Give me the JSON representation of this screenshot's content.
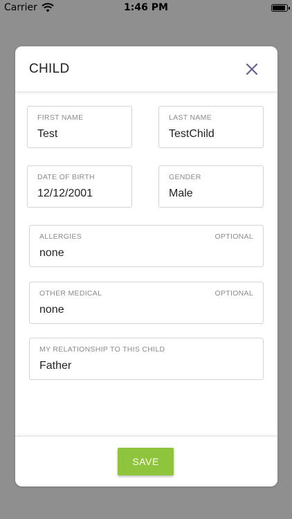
{
  "status_bar": {
    "carrier": "Carrier",
    "time": "1:46 PM",
    "icons": [
      "wifi-icon",
      "battery-icon"
    ]
  },
  "modal": {
    "title": "CHILD",
    "close_icon": "close-icon",
    "fields": {
      "first_name": {
        "label": "FIRST NAME",
        "value": "Test"
      },
      "last_name": {
        "label": "LAST NAME",
        "value": "TestChild"
      },
      "date_of_birth": {
        "label": "DATE OF BIRTH",
        "value": "12/12/2001"
      },
      "gender": {
        "label": "GENDER",
        "value": "Male"
      },
      "allergies": {
        "label": "ALLERGIES",
        "optional": "OPTIONAL",
        "value": "none"
      },
      "other_medical": {
        "label": "OTHER MEDICAL",
        "optional": "OPTIONAL",
        "value": "none"
      },
      "relationship": {
        "label": "MY RELATIONSHIP TO THIS CHILD",
        "value": "Father"
      }
    },
    "save_label": "SAVE"
  },
  "colors": {
    "backdrop": "#8f8f8f",
    "save_button": "#8fc43d",
    "close_icon": "#6a5d8f"
  }
}
